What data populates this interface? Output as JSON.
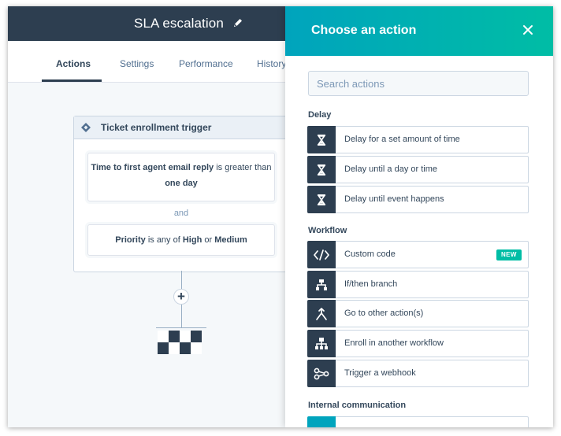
{
  "header": {
    "title": "SLA escalation"
  },
  "tabs": [
    {
      "label": "Actions",
      "active": true
    },
    {
      "label": "Settings"
    },
    {
      "label": "Performance"
    },
    {
      "label": "History"
    }
  ],
  "trigger": {
    "title": "Ticket enrollment trigger",
    "condition1": {
      "property": "Time to first agent email reply",
      "operator": "is greater than",
      "value": "one day"
    },
    "joiner": "and",
    "condition2": {
      "property": "Priority",
      "operator": "is any of",
      "value1": "High",
      "connector": "or",
      "value2": "Medium"
    }
  },
  "panel": {
    "title": "Choose an action",
    "search_placeholder": "Search actions",
    "sections": [
      {
        "label": "Delay",
        "items": [
          {
            "label": "Delay for a set amount of time",
            "icon": "hourglass-icon"
          },
          {
            "label": "Delay until a day or time",
            "icon": "hourglass-icon"
          },
          {
            "label": "Delay until event happens",
            "icon": "hourglass-icon"
          }
        ]
      },
      {
        "label": "Workflow",
        "items": [
          {
            "label": "Custom code",
            "icon": "code-icon",
            "badge": "NEW"
          },
          {
            "label": "If/then branch",
            "icon": "branch-icon"
          },
          {
            "label": "Go to other action(s)",
            "icon": "goto-icon"
          },
          {
            "label": "Enroll in another workflow",
            "icon": "workflow-icon"
          },
          {
            "label": "Trigger a webhook",
            "icon": "webhook-icon"
          }
        ]
      },
      {
        "label": "Internal communication",
        "items": []
      }
    ]
  },
  "colors": {
    "header_bg": "#2d3e50",
    "panel_gradient_start": "#00a4bd",
    "panel_gradient_end": "#00bda5",
    "icon_tile": "#2d3e50",
    "badge": "#00bda5"
  }
}
